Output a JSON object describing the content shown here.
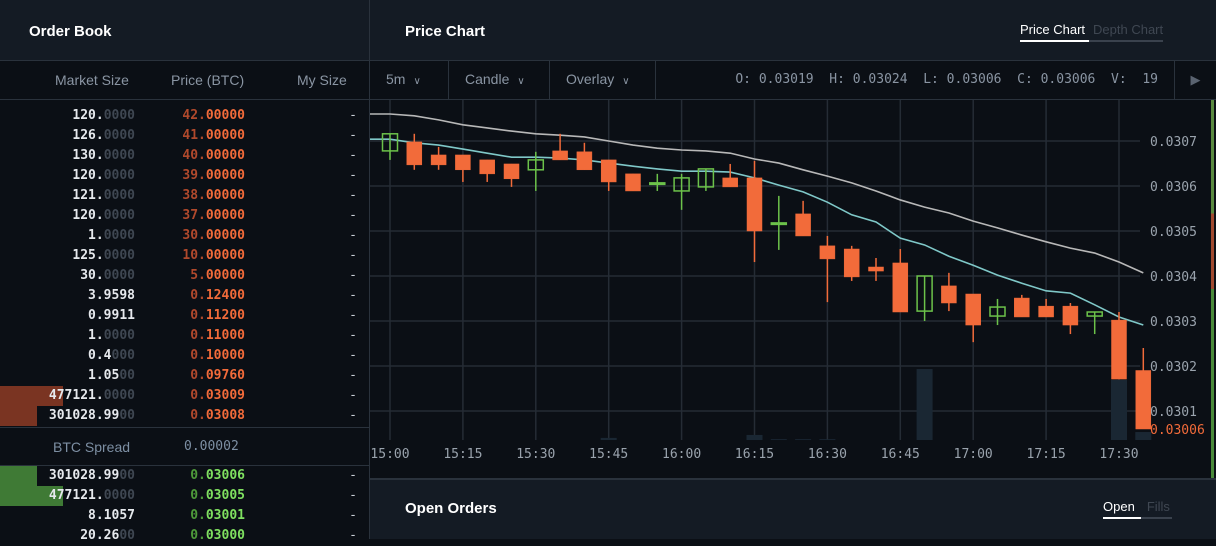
{
  "order_book": {
    "title": "Order Book",
    "columns": {
      "market_size": "Market Size",
      "price": "Price (BTC)",
      "my_size": "My Size"
    },
    "asks": [
      {
        "size": "120.",
        "size_dim": "0000",
        "price_a": "42.",
        "price_b": "00000",
        "my": "-",
        "depth": 0
      },
      {
        "size": "126.",
        "size_dim": "0000",
        "price_a": "41.",
        "price_b": "00000",
        "my": "-",
        "depth": 0
      },
      {
        "size": "130.",
        "size_dim": "0000",
        "price_a": "40.",
        "price_b": "00000",
        "my": "-",
        "depth": 0
      },
      {
        "size": "120.",
        "size_dim": "0000",
        "price_a": "39.",
        "price_b": "00000",
        "my": "-",
        "depth": 0
      },
      {
        "size": "121.",
        "size_dim": "0000",
        "price_a": "38.",
        "price_b": "00000",
        "my": "-",
        "depth": 0
      },
      {
        "size": "120.",
        "size_dim": "0000",
        "price_a": "37.",
        "price_b": "00000",
        "my": "-",
        "depth": 0
      },
      {
        "size": "1.",
        "size_dim": "0000",
        "price_a": "30.",
        "price_b": "00000",
        "my": "-",
        "depth": 0
      },
      {
        "size": "125.",
        "size_dim": "0000",
        "price_a": "10.",
        "price_b": "00000",
        "my": "-",
        "depth": 0
      },
      {
        "size": "30.",
        "size_dim": "0000",
        "price_a": "5.",
        "price_b": "00000",
        "my": "-",
        "depth": 0
      },
      {
        "size": "3.9598",
        "size_dim": "",
        "price_a": "0.",
        "price_b": "12400",
        "my": "-",
        "depth": 0
      },
      {
        "size": "0.9911",
        "size_dim": "",
        "price_a": "0.",
        "price_b": "11200",
        "my": "-",
        "depth": 0
      },
      {
        "size": "1.",
        "size_dim": "0000",
        "price_a": "0.",
        "price_b": "11000",
        "my": "-",
        "depth": 0
      },
      {
        "size": "0.4",
        "size_dim": "000",
        "price_a": "0.",
        "price_b": "10000",
        "my": "-",
        "depth": 0
      },
      {
        "size": "1.05",
        "size_dim": "00",
        "price_a": "0.",
        "price_b": "09760",
        "my": "-",
        "depth": 0
      },
      {
        "size": "477121.",
        "size_dim": "0000",
        "price_a": "0.",
        "price_b": "03009",
        "my": "-",
        "depth": 1.0
      },
      {
        "size": "301028.99",
        "size_dim": "00",
        "price_a": "0.",
        "price_b": "03008",
        "my": "-",
        "depth": 0.59
      }
    ],
    "spread": {
      "label": "BTC Spread",
      "value": "0.00002"
    },
    "bids": [
      {
        "size": "301028.99",
        "size_dim": "00",
        "price_a": "0.",
        "price_b": "03006",
        "my": "-",
        "depth": 0.59
      },
      {
        "size": "477121.",
        "size_dim": "0000",
        "price_a": "0.",
        "price_b": "03005",
        "my": "-",
        "depth": 1.0
      },
      {
        "size": "8.1057",
        "size_dim": "",
        "price_a": "0.",
        "price_b": "03001",
        "my": "-",
        "depth": 0
      },
      {
        "size": "20.26",
        "size_dim": "00",
        "price_a": "0.",
        "price_b": "03000",
        "my": "-",
        "depth": 0
      }
    ]
  },
  "price_chart": {
    "title": "Price Chart",
    "tabs": [
      {
        "label": "Price Chart",
        "active": true
      },
      {
        "label": "Depth Chart",
        "active": false
      }
    ],
    "interval": "5m",
    "chart_type": "Candle",
    "overlay": "Overlay",
    "ohlcv": "O: 0.03019  H: 0.03024  L: 0.03006  C: 0.03006  V:  19",
    "play_icon": "play-icon"
  },
  "open_orders": {
    "title": "Open Orders",
    "tabs": [
      {
        "label": "Open",
        "active": true
      },
      {
        "label": "Fills",
        "active": false
      }
    ]
  },
  "colors": {
    "up": "#6cc24a",
    "down": "#f26b3a",
    "ma_fast": "#7fc8c8",
    "ma_slow": "#b8b8b8",
    "grid": "#252c35",
    "volume": "#1a2733"
  },
  "chart_data": {
    "type": "candlestick",
    "x_ticks": [
      "15:00",
      "15:15",
      "15:30",
      "15:45",
      "16:00",
      "16:15",
      "16:30",
      "16:45",
      "17:00",
      "17:15",
      "17:30"
    ],
    "y_ticks": [
      "0.0307",
      "0.0306",
      "0.0305",
      "0.0304",
      "0.0303",
      "0.0302",
      "0.0301"
    ],
    "ylim": [
      0.03,
      0.03079
    ],
    "interval_minutes": 5,
    "last_price_label": "0.03006",
    "grid": true,
    "candles": [
      [
        0.030678,
        0.030716,
        0.030658,
        0.030716
      ],
      [
        0.030698,
        0.030716,
        0.030636,
        0.030647
      ],
      [
        0.030669,
        0.030687,
        0.030636,
        0.030647
      ],
      [
        0.030669,
        0.030669,
        0.030609,
        0.030636
      ],
      [
        0.030658,
        0.030658,
        0.030609,
        0.030627
      ],
      [
        0.030649,
        0.030649,
        0.030598,
        0.030616
      ],
      [
        0.030636,
        0.030676,
        0.030589,
        0.030658
      ],
      [
        0.030678,
        0.030716,
        0.030658,
        0.030658
      ],
      [
        0.030676,
        0.030696,
        0.030636,
        0.030636
      ],
      [
        0.030658,
        0.030658,
        0.030589,
        0.030609
      ],
      [
        0.030627,
        0.030627,
        0.030589,
        0.030589
      ],
      [
        0.030606,
        0.030627,
        0.030589,
        0.030607
      ],
      [
        0.030589,
        0.030627,
        0.030547,
        0.030618
      ],
      [
        0.030598,
        0.030638,
        0.030589,
        0.030638
      ],
      [
        0.030618,
        0.030649,
        0.030598,
        0.030598
      ],
      [
        0.030618,
        0.030656,
        0.030431,
        0.0305
      ],
      [
        0.030517,
        0.030578,
        0.030458,
        0.030518
      ],
      [
        0.030538,
        0.030567,
        0.030489,
        0.030489
      ],
      [
        0.030467,
        0.030489,
        0.030342,
        0.030438
      ],
      [
        0.03046,
        0.030467,
        0.030389,
        0.030398
      ],
      [
        0.03042,
        0.03044,
        0.030389,
        0.030411
      ],
      [
        0.030429,
        0.03046,
        0.03032,
        0.03032
      ],
      [
        0.030322,
        0.0304,
        0.0303,
        0.0304
      ],
      [
        0.030378,
        0.030407,
        0.030322,
        0.03034
      ],
      [
        0.03036,
        0.03036,
        0.030253,
        0.030291
      ],
      [
        0.030311,
        0.030349,
        0.030291,
        0.030331
      ],
      [
        0.030351,
        0.030358,
        0.030309,
        0.030309
      ],
      [
        0.030333,
        0.030349,
        0.030309,
        0.030309
      ],
      [
        0.030333,
        0.03034,
        0.030271,
        0.030291
      ],
      [
        0.030311,
        0.03032,
        0.030271,
        0.03032
      ],
      [
        0.030302,
        0.03032,
        0.030171,
        0.030171
      ],
      [
        0.03019,
        0.03024,
        0.03006,
        0.03006
      ]
    ],
    "candle_format": [
      "open",
      "high",
      "low",
      "close"
    ],
    "volumes": [
      0,
      0,
      0,
      0,
      0,
      0,
      0,
      0,
      0,
      5,
      0,
      0,
      0,
      0,
      0,
      12,
      2,
      2,
      2,
      0,
      0,
      0,
      169,
      0,
      0,
      0,
      0,
      0,
      0,
      0,
      143,
      19
    ],
    "overlays": [
      {
        "values": [
          0.03076,
          0.030756,
          0.030747,
          0.030736,
          0.030729,
          0.030722,
          0.030716,
          0.030713,
          0.030709,
          0.0307,
          0.030691,
          0.030684,
          0.03068,
          0.030678,
          0.030673,
          0.03066,
          0.030651,
          0.030636,
          0.030622,
          0.030607,
          0.030589,
          0.030569,
          0.030553,
          0.03054,
          0.030522,
          0.030507,
          0.030491,
          0.030476,
          0.030462,
          0.030451,
          0.030431,
          0.030407
        ]
      },
      {
        "values": [
          0.030704,
          0.030696,
          0.030691,
          0.030682,
          0.030673,
          0.030664,
          0.030664,
          0.030662,
          0.030658,
          0.030651,
          0.030644,
          0.030638,
          0.030633,
          0.030633,
          0.030631,
          0.030618,
          0.030602,
          0.030587,
          0.030564,
          0.030536,
          0.03052,
          0.030484,
          0.030469,
          0.030444,
          0.030424,
          0.030402,
          0.030384,
          0.030367,
          0.030362,
          0.030336,
          0.030309,
          0.030291
        ]
      }
    ]
  }
}
